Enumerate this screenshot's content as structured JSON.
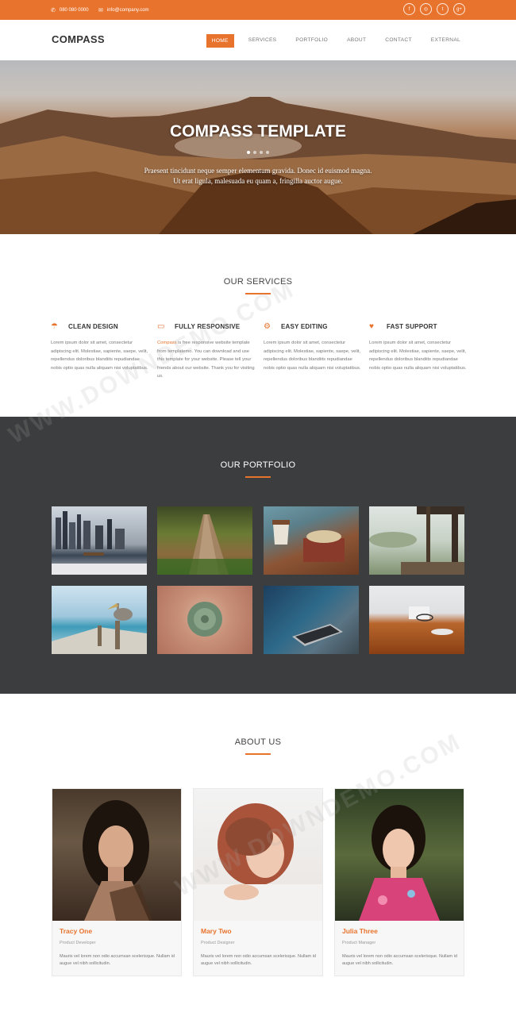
{
  "topbar": {
    "phone": "080 080 0000",
    "email": "info@company.com",
    "social": [
      {
        "icon": "facebook-icon",
        "glyph": "f"
      },
      {
        "icon": "dribbble-icon",
        "glyph": "◎"
      },
      {
        "icon": "twitter-icon",
        "glyph": "t"
      },
      {
        "icon": "google-plus-icon",
        "glyph": "g+"
      }
    ]
  },
  "header": {
    "logo": "COMPASS",
    "nav": [
      "HOME",
      "SERVICES",
      "PORTFOLIO",
      "ABOUT",
      "CONTACT",
      "EXTERNAL"
    ]
  },
  "hero": {
    "title": "COMPASS TEMPLATE",
    "line1": "Praesent tincidunt neque semper elementum gravida. Donec id euismod magna.",
    "line2": "Ut erat ligula, malesuada eu quam a, fringilla auctor augue."
  },
  "services": {
    "title": "OUR SERVICES",
    "items": [
      {
        "icon": "umbrella-icon",
        "glyph": "☂",
        "title": "CLEAN DESIGN",
        "text": "Lorem ipsum dolor sit amet, consectetur adipiscing elit. Molestiae, sapiente, saepe, velit, repellendus doloribus blandiits repudiandae nobis optio quas nulla aliquam nisi voluptatibus."
      },
      {
        "icon": "monitor-icon",
        "glyph": "▭",
        "title": "FULLY RESPONSIVE",
        "text_link": "Compass",
        "text": " is free responsive website template from templatemo. You can download and use this template for your website. Please tell your friends about our website. Thank you for visiting us."
      },
      {
        "icon": "gears-icon",
        "glyph": "⚙",
        "title": "EASY EDITING",
        "text": "Lorem ipsum dolor sit amet, consectetur adipiscing elit. Molestiae, sapiente, saepe, velit, repellendus doloribus blandiits repudiandae nobis optio quas nulla aliquam nisi voluptatibus."
      },
      {
        "icon": "heart-icon",
        "glyph": "♥",
        "title": "FAST SUPPORT",
        "text": "Lorem ipsum dolor sit amet, consectetur adipiscing elit. Molestiae, sapiente, saepe, velit, repellendus doloribus blandiits repudiandae nobis optio quas nulla aliquam nisi voluptatibus."
      }
    ]
  },
  "portfolio": {
    "title": "OUR PORTFOLIO"
  },
  "about": {
    "title": "ABOUT US",
    "team": [
      {
        "name": "Tracy One",
        "role": "Product Developer",
        "bio": "Mauris vel lorem non odio accumsan scelerisque. Nullam id augue vel nibh sollicitudin."
      },
      {
        "name": "Mary Two",
        "role": "Product Designer",
        "bio": "Mauris vel lorem non odio accumsan scelerisque. Nullam id augue vel nibh sollicitudin."
      },
      {
        "name": "Julia Three",
        "role": "Product Manager",
        "bio": "Mauris vel lorem non odio accumsan scelerisque. Nullam id augue vel nibh sollicitudin."
      }
    ]
  },
  "watermark": "WWW.DOWNDEMO.COM",
  "colors": {
    "accent": "#e8732d",
    "dark": "#3c3d3e"
  }
}
